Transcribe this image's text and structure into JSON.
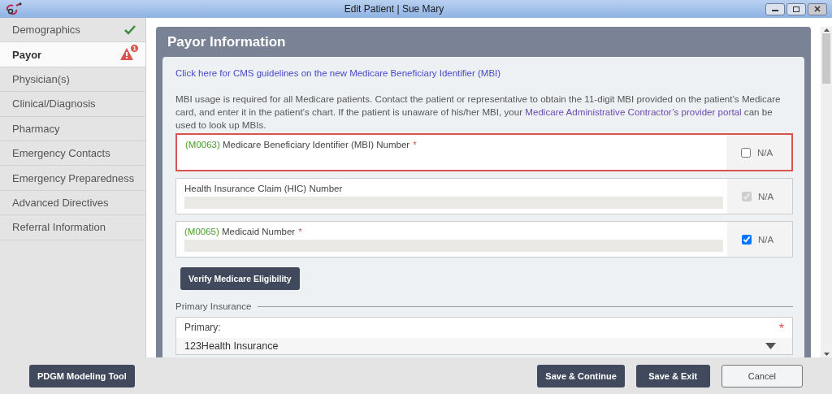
{
  "window": {
    "title": "Edit Patient | Sue Mary"
  },
  "sidebar": {
    "items": [
      {
        "label": "Demographics",
        "selected": false,
        "kind": "done"
      },
      {
        "label": "Payor",
        "selected": true,
        "kind": "warning",
        "badge": "1"
      },
      {
        "label": "Physician(s)",
        "selected": false
      },
      {
        "label": "Clinical/Diagnosis",
        "selected": false
      },
      {
        "label": "Pharmacy",
        "selected": false
      },
      {
        "label": "Emergency Contacts",
        "selected": false
      },
      {
        "label": "Emergency Preparedness",
        "selected": false
      },
      {
        "label": "Advanced Directives",
        "selected": false
      },
      {
        "label": "Referral Information",
        "selected": false
      }
    ]
  },
  "panel": {
    "title": "Payor Information",
    "guideline_link": "Click here for CMS guidelines on the new Medicare Beneficiary Identifier (MBI)",
    "notice": [
      {
        "kind": "text",
        "text": "MBI usage is required for all Medicare patients. Contact the patient or representative to obtain the 11-digit MBI provided on the patient’s Medicare card, and enter it in the patient’s chart. If the patient is unaware of his/her MBI, your "
      },
      {
        "kind": "link",
        "text": "Medicare Administrative Contractor’s provider portal"
      },
      {
        "kind": "text",
        "text": " can be used to look up MBIs."
      }
    ],
    "fields": [
      {
        "code": "(M0063)",
        "label": "Medicare Beneficiary Identifier (MBI) Number",
        "required": "*",
        "error": true,
        "disabled": false,
        "na": {
          "label": "N/A",
          "checked": false,
          "disabled": false
        }
      },
      {
        "label": "Health Insurance Claim (HIC) Number",
        "error": false,
        "disabled": true,
        "na": {
          "label": "N/A",
          "checked": true,
          "disabled": true
        }
      },
      {
        "code": "(M0065)",
        "label": "Medicaid Number",
        "required": "*",
        "error": false,
        "disabled": true,
        "na": {
          "label": "N/A",
          "checked": true,
          "disabled": false
        }
      }
    ],
    "verify_button": "Verify Medicare Eligibility",
    "primary_insurance": {
      "legend": "Primary Insurance",
      "label": "Primary:",
      "required": "*",
      "value": "123Health Insurance"
    }
  },
  "footer": {
    "left_button": "PDGM Modeling Tool",
    "buttons": [
      {
        "label": "Save & Continue",
        "kind": "primary"
      },
      {
        "label": "Save & Exit",
        "kind": "primary"
      },
      {
        "label": "Cancel",
        "kind": "secondary"
      }
    ]
  }
}
